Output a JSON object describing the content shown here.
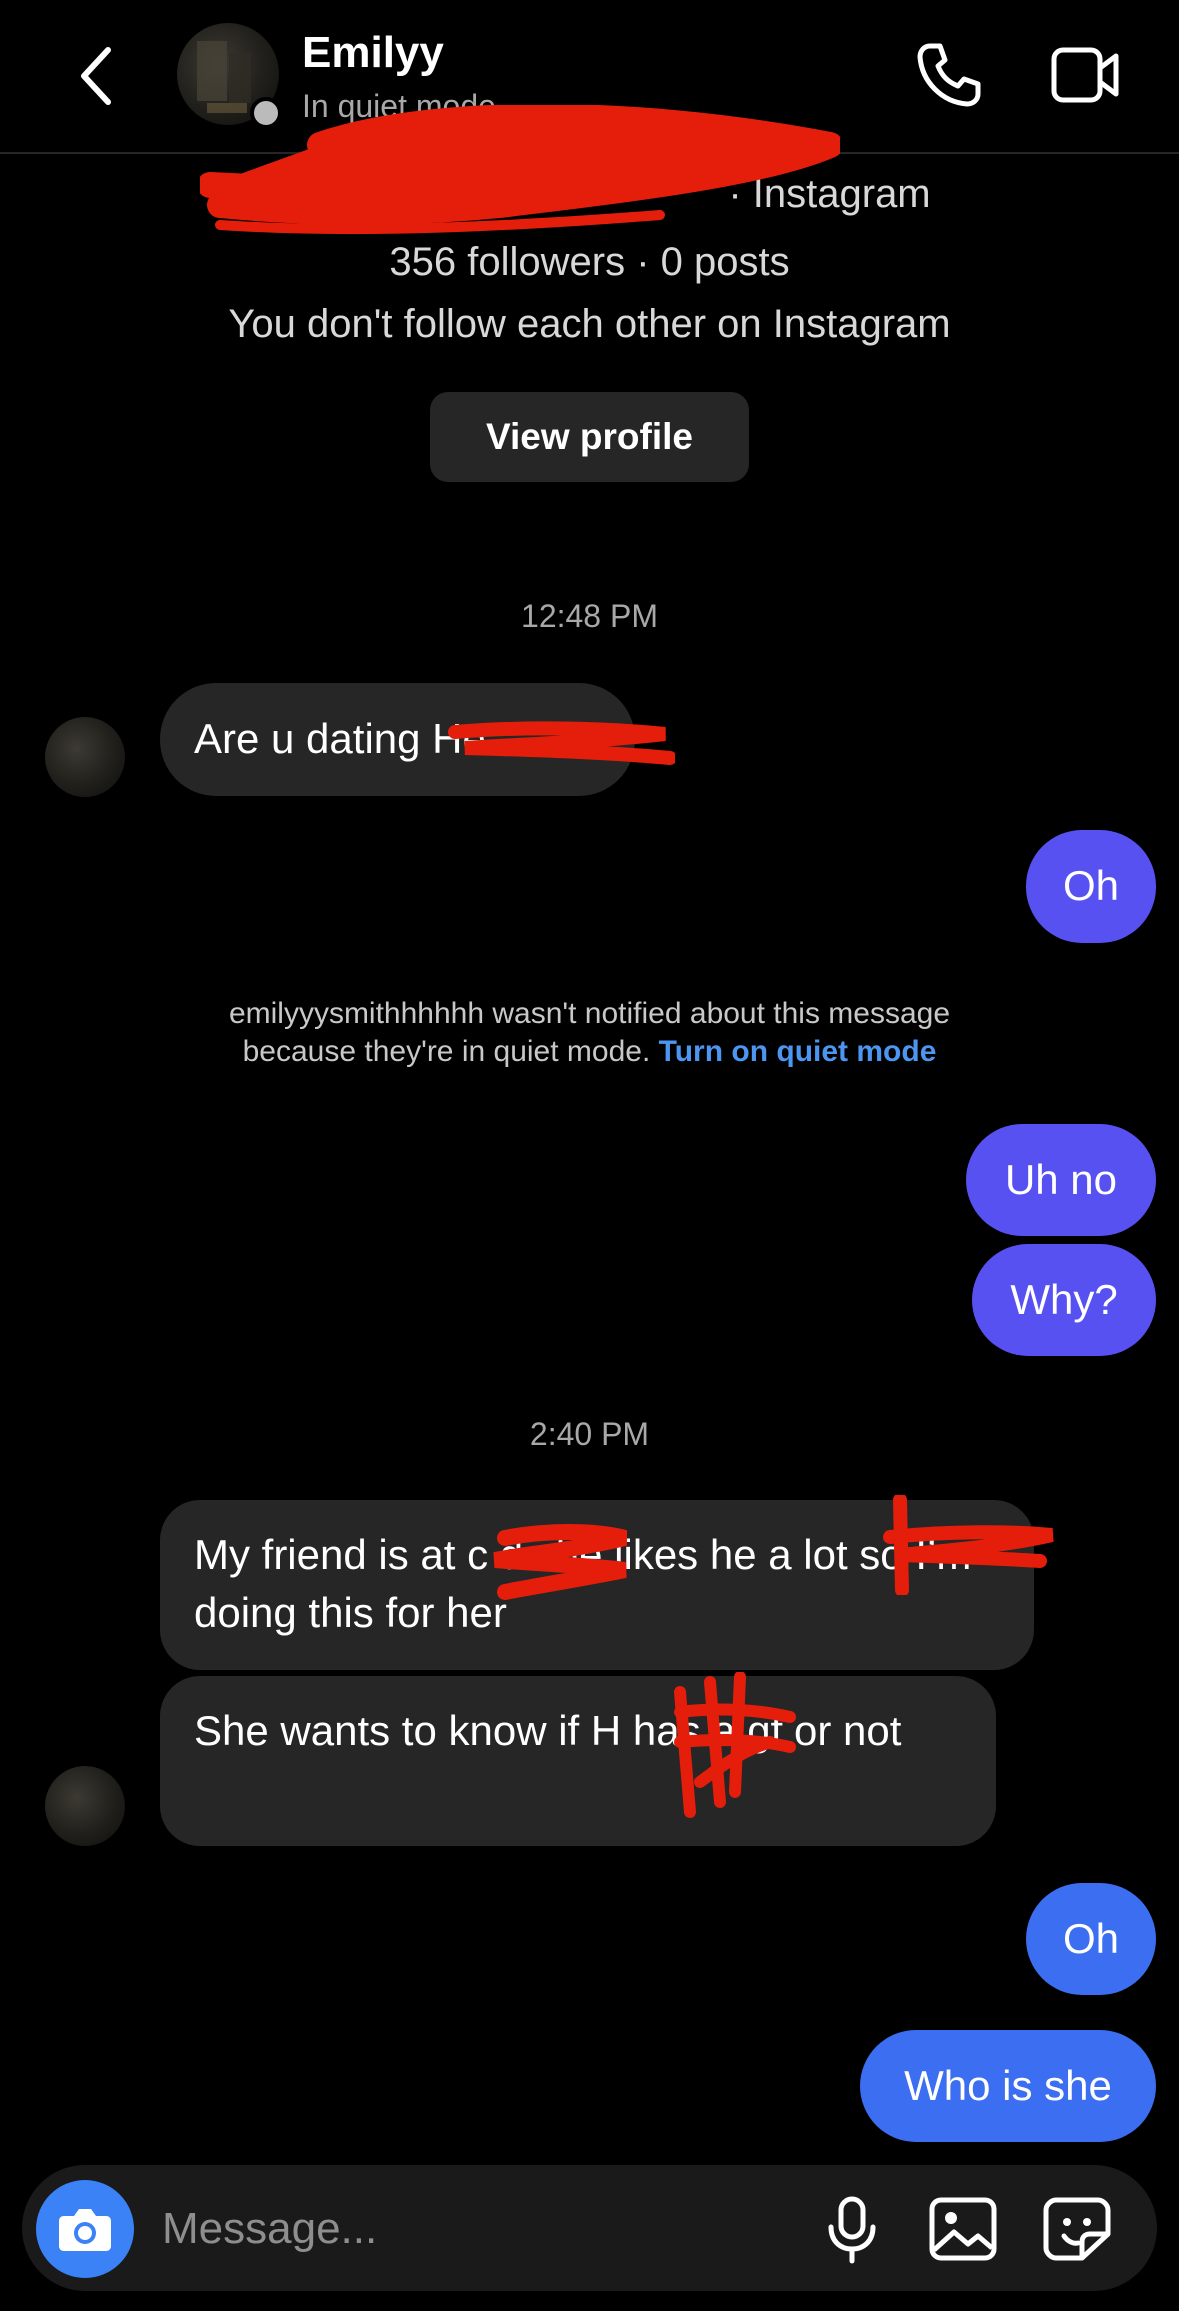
{
  "header": {
    "contact_name": "Emilyy",
    "contact_status": "In quiet mode",
    "icons": {
      "back": "chevron-left-icon",
      "call": "phone-icon",
      "video": "video-camera-icon"
    }
  },
  "profile": {
    "handle_suffix": "· Instagram",
    "stats": "356 followers · 0 posts",
    "follow_status": "You don't follow each other on Instagram",
    "view_profile_label": "View profile"
  },
  "conversation": {
    "timestamp_1": "12:48 PM",
    "msg_1": "Are u dating He",
    "msg_2": "Oh",
    "quiet_notice_line1": "emilyyysmithhhhhh wasn't notified about this message",
    "quiet_notice_line2": "because they're in quiet mode.",
    "quiet_notice_link": "Turn on quiet mode",
    "msg_3": "Uh no",
    "msg_4": "Why?",
    "timestamp_2": "2:40 PM",
    "msg_5": "My friend is at c        d she likes he          a lot so I’m doing this for her",
    "msg_6": "She wants to know if H       has a gf or not",
    "msg_7": "Oh",
    "msg_8": "Who is she"
  },
  "composer": {
    "placeholder": "Message...",
    "icons": {
      "camera": "camera-icon",
      "mic": "microphone-icon",
      "gallery": "image-icon",
      "sticker": "sticker-icon"
    }
  },
  "colors": {
    "background": "#000000",
    "incoming_bubble": "#262626",
    "outgoing_purple": "#5851f2",
    "outgoing_blue": "#3b6ef0",
    "link": "#4c95f0",
    "redaction": "#e41e0b"
  }
}
